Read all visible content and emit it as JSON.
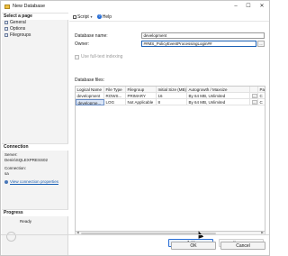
{
  "window": {
    "title": "New Database",
    "minimize": "–",
    "maximize": "☐",
    "close": "✕"
  },
  "left": {
    "select_page_header": "Select a page",
    "pages": [
      "General",
      "Options",
      "Filegroups"
    ],
    "connection_header": "Connection",
    "server_label": "Server:",
    "server_value": "Denis\\SQLEXPRESS02",
    "connection_label": "Connection:",
    "connection_value": "sa",
    "view_props_link": "View connection properties",
    "progress_header": "Progress",
    "progress_status": "Ready"
  },
  "toolbar": {
    "script_label": "Script",
    "help_label": "Help"
  },
  "form": {
    "db_name_label": "Database name:",
    "db_name_value": "development",
    "owner_label": "Owner:",
    "owner_value": "##MS_PolicyEventProcessingLogin##",
    "fulltext_label": "Use full-text indexing",
    "files_label": "Database files:",
    "browse_label": "..."
  },
  "grid": {
    "columns": [
      "Logical Name",
      "File Type",
      "Filegroup",
      "Initial Size (MB)",
      "Autogrowth / Maxsize",
      "",
      "Pa"
    ],
    "rows": [
      [
        "development",
        "ROWS...",
        "PRIMARY",
        "16",
        "By 64 MB, Unlimited",
        "...",
        "C"
      ],
      [
        "developme...",
        "LOG",
        "Not Applicable",
        "8",
        "By 64 MB, Unlimited",
        "...",
        "C"
      ]
    ]
  },
  "buttons": {
    "add": "Add",
    "remove": "Remove",
    "ok": "OK",
    "cancel": "Cancel"
  }
}
